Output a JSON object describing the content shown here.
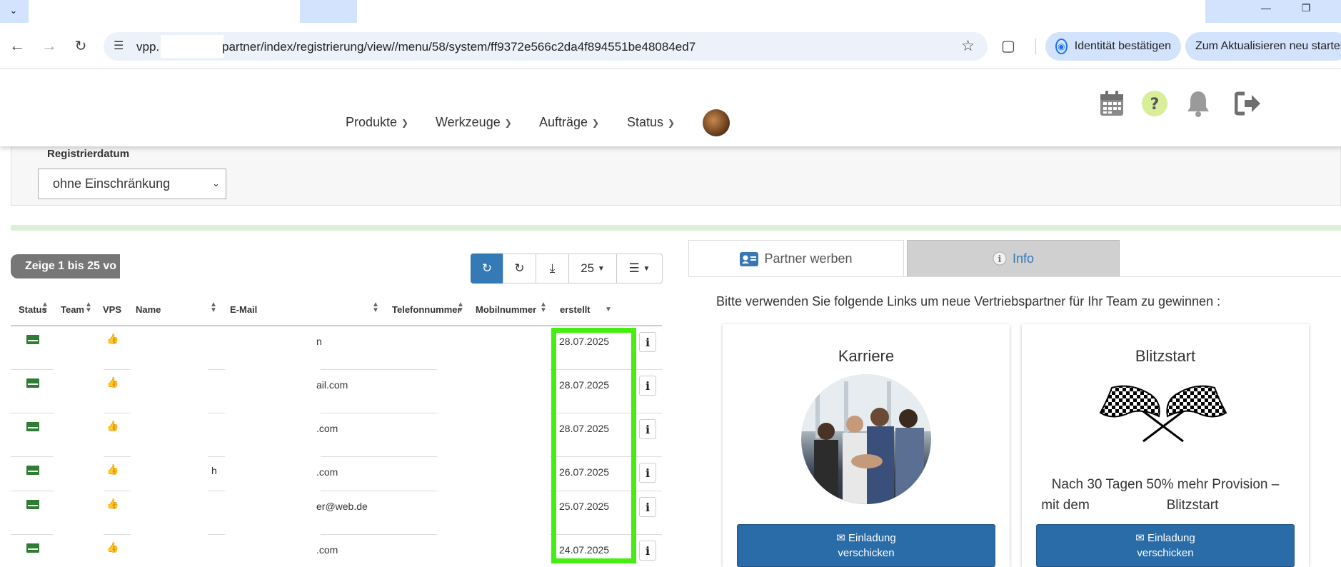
{
  "browser": {
    "url_prefix": "vpp.",
    "url_rest": "partner/index/registrierung/view//menu/58/system/ff9372e566c2da4f894551be48084ed7",
    "identity_button": "Identität bestätigen",
    "update_button": "Zum Aktualisieren neu starten"
  },
  "nav": {
    "menu": [
      "Produkte",
      "Werkzeuge",
      "Aufträge",
      "Status"
    ]
  },
  "filter": {
    "label": "Registrierdatum",
    "value": "ohne Einschränkung"
  },
  "table": {
    "info_text": "Zeige 1 bis 25 vo",
    "page_size": "25",
    "columns": [
      "Status",
      "Team",
      "VPS",
      "Name",
      "E-Mail",
      "Telefonnummer",
      "Mobilnummer",
      "erstellt"
    ],
    "rows": [
      {
        "name": "",
        "email": "n",
        "created": "28.07.2025"
      },
      {
        "name": "",
        "email": "ail.com",
        "created": "28.07.2025"
      },
      {
        "name": "",
        "email": ".com",
        "created": "28.07.2025"
      },
      {
        "name": "h",
        "email": ".com",
        "created": "26.07.2025"
      },
      {
        "name": "",
        "email": "er@web.de",
        "created": "25.07.2025"
      },
      {
        "name": "",
        "email": ".com",
        "created": "24.07.2025"
      }
    ]
  },
  "recruit": {
    "tab_active": "Partner werben",
    "tab_info": "Info",
    "intro": "Bitte verwenden Sie folgende Links um neue Vertriebspartner für Ihr Team zu gewinnen :",
    "card1": {
      "title": "Karriere",
      "button_line1": "Einladung",
      "button_line2": "verschicken"
    },
    "card2": {
      "title": "Blitzstart",
      "text_line1": "Nach 30 Tagen 50% mehr Provision –",
      "text_line2a": "mit dem",
      "text_line2b": "Blitzstart",
      "button_line1": "Einladung",
      "button_line2": "verschicken"
    }
  }
}
